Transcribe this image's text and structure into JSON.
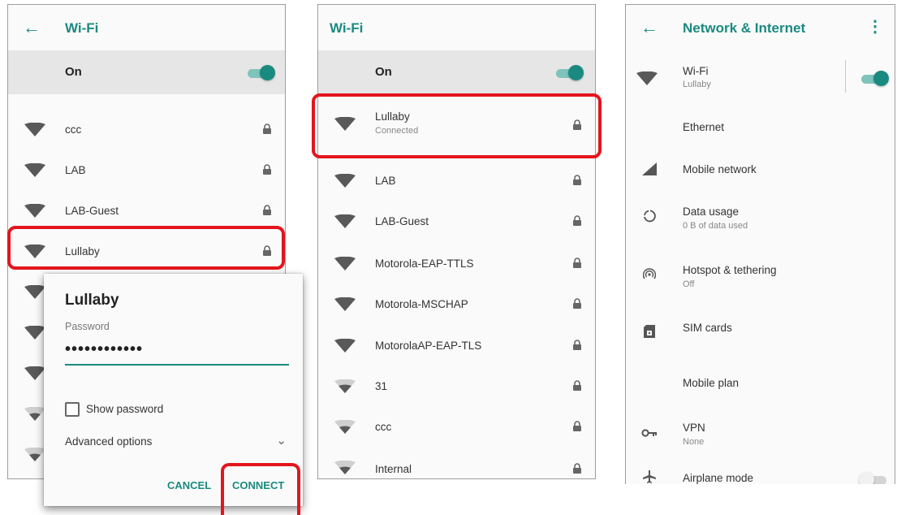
{
  "left": {
    "title": "Wi-Fi",
    "on_label": "On",
    "networks": [
      {
        "name": "ccc",
        "strength": "full"
      },
      {
        "name": "LAB",
        "strength": "full"
      },
      {
        "name": "LAB-Guest",
        "strength": "full"
      },
      {
        "name": "Lullaby",
        "strength": "full"
      },
      {
        "name": "",
        "strength": "full"
      },
      {
        "name": "",
        "strength": "full"
      },
      {
        "name": "",
        "strength": "full"
      },
      {
        "name": "",
        "strength": "weak"
      },
      {
        "name": "",
        "strength": "weak"
      }
    ],
    "dialog": {
      "title": "Lullaby",
      "password_label": "Password",
      "password_value": "••••••••••••",
      "show_password": "Show password",
      "advanced_options": "Advanced options",
      "cancel": "CANCEL",
      "connect": "CONNECT"
    }
  },
  "middle": {
    "title": "Wi-Fi",
    "on_label": "On",
    "connected": {
      "name": "Lullaby",
      "status": "Connected"
    },
    "networks": [
      {
        "name": "LAB",
        "strength": "full"
      },
      {
        "name": "LAB-Guest",
        "strength": "full"
      },
      {
        "name": "Motorola-EAP-TTLS",
        "strength": "full"
      },
      {
        "name": "Motorola-MSCHAP",
        "strength": "full"
      },
      {
        "name": "MotorolaAP-EAP-TLS",
        "strength": "full"
      },
      {
        "name": "31",
        "strength": "weak"
      },
      {
        "name": "ccc",
        "strength": "weak"
      },
      {
        "name": "Internal",
        "strength": "weak"
      }
    ]
  },
  "right": {
    "title": "Network & Internet",
    "items": [
      {
        "title": "Wi-Fi",
        "subtitle": "Lullaby",
        "icon": "wifi-icon"
      },
      {
        "title": "Ethernet",
        "subtitle": "",
        "icon": ""
      },
      {
        "title": "Mobile network",
        "subtitle": "",
        "icon": "signal-icon"
      },
      {
        "title": "Data usage",
        "subtitle": "0 B of data used",
        "icon": "data-usage-icon"
      },
      {
        "title": "Hotspot & tethering",
        "subtitle": "Off",
        "icon": "hotspot-icon"
      },
      {
        "title": "SIM cards",
        "subtitle": "",
        "icon": "sim-card-icon"
      },
      {
        "title": "Mobile plan",
        "subtitle": "",
        "icon": ""
      },
      {
        "title": "VPN",
        "subtitle": "None",
        "icon": "vpn-key-icon"
      },
      {
        "title": "Airplane mode",
        "subtitle": "",
        "icon": "airplane-icon"
      }
    ]
  },
  "colors": {
    "accent": "#1a8a80",
    "highlight": "#e4151d",
    "onbar": "#e6e6e6"
  }
}
